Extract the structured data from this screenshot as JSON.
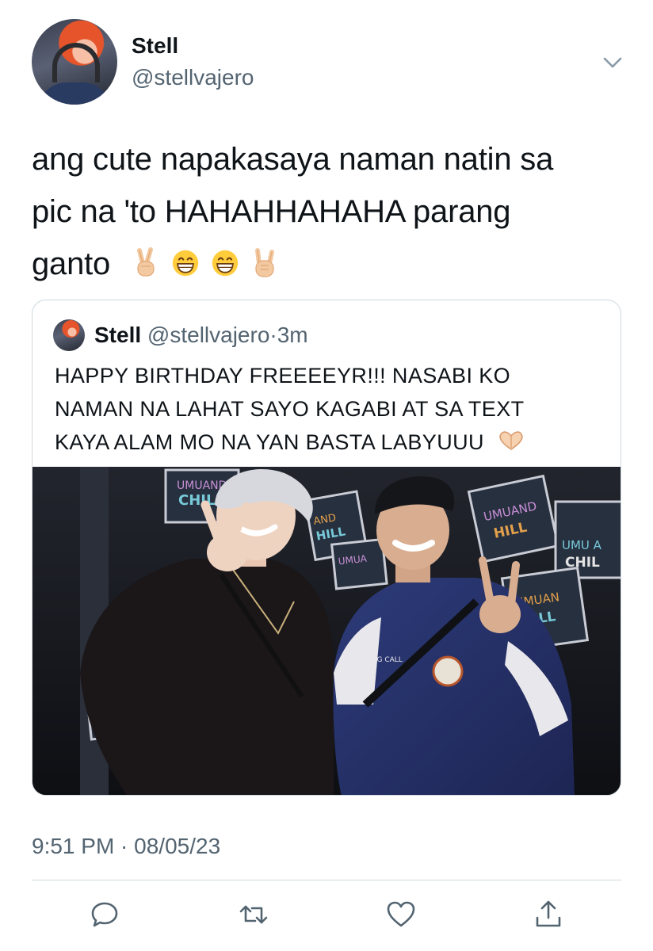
{
  "author": {
    "name": "Stell",
    "handle": "@stellvajero"
  },
  "tweet": {
    "line1": "ang cute napakasaya naman natin sa",
    "line2": "pic na 'to HAHAHHAHAHA parang",
    "line3": "ganto",
    "emojis": [
      "victory-hand",
      "grinning-face",
      "grinning-face",
      "rock-on-hand"
    ],
    "timestamp": "9:51 PM · 08/05/23"
  },
  "quoted": {
    "name": "Stell",
    "handle": "@stellvajero",
    "separator": "·",
    "time": "3m",
    "line1": "HAPPY BIRTHDAY FREEEEYR!!! NASABI KO",
    "line2": "NAMAN NA LAHAT SAYO KAGABI AT SA TEXT",
    "line3": "KAYA ALAM MO NA YAN BASTA LABYUUU",
    "emoji": "heart-hands",
    "photo": {
      "poster_text_1": "UMUAND",
      "poster_text_2": "CHILL",
      "jacket_text": "COMING CALL"
    }
  },
  "actions": [
    "reply-icon",
    "retweet-icon",
    "like-icon",
    "share-icon"
  ],
  "colors": {
    "text": "#0f1419",
    "secondary": "#536471",
    "border": "#cfd9de",
    "action_icon": "#536471"
  }
}
